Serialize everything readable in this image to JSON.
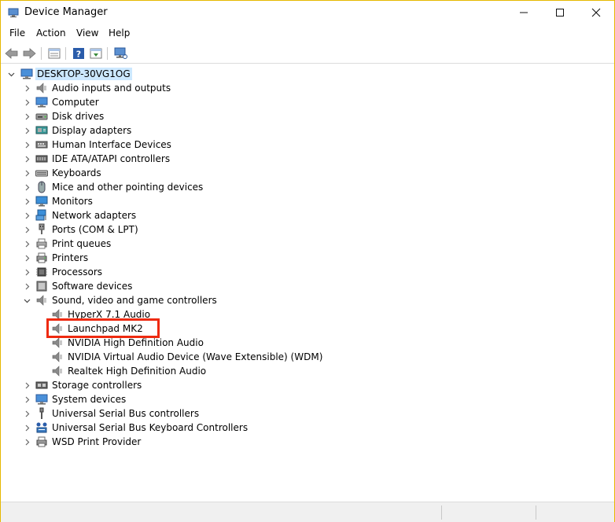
{
  "window": {
    "title": "Device Manager"
  },
  "menu": [
    "File",
    "Action",
    "View",
    "Help"
  ],
  "tree": {
    "root": "DESKTOP-30VG1OG",
    "categories": [
      {
        "label": "Audio inputs and outputs",
        "icon": "speaker-icon"
      },
      {
        "label": "Computer",
        "icon": "computer-icon"
      },
      {
        "label": "Disk drives",
        "icon": "disk-drive-icon"
      },
      {
        "label": "Display adapters",
        "icon": "display-adapter-icon"
      },
      {
        "label": "Human Interface Devices",
        "icon": "hid-icon"
      },
      {
        "label": "IDE ATA/ATAPI controllers",
        "icon": "ide-controller-icon"
      },
      {
        "label": "Keyboards",
        "icon": "keyboard-icon"
      },
      {
        "label": "Mice and other pointing devices",
        "icon": "mouse-icon"
      },
      {
        "label": "Monitors",
        "icon": "monitor-icon"
      },
      {
        "label": "Network adapters",
        "icon": "network-adapter-icon"
      },
      {
        "label": "Ports (COM & LPT)",
        "icon": "port-icon"
      },
      {
        "label": "Print queues",
        "icon": "print-queue-icon"
      },
      {
        "label": "Printers",
        "icon": "printer-icon"
      },
      {
        "label": "Processors",
        "icon": "processor-icon"
      },
      {
        "label": "Software devices",
        "icon": "software-device-icon"
      },
      {
        "label": "Sound, video and game controllers",
        "icon": "speaker-icon"
      }
    ],
    "sound_children": [
      "HyperX 7.1 Audio",
      "Launchpad MK2",
      "NVIDIA High Definition Audio",
      "NVIDIA Virtual Audio Device (Wave Extensible) (WDM)",
      "Realtek High Definition Audio"
    ],
    "categories_after": [
      {
        "label": "Storage controllers",
        "icon": "storage-controller-icon"
      },
      {
        "label": "System devices",
        "icon": "system-device-icon"
      },
      {
        "label": "Universal Serial Bus controllers",
        "icon": "usb-icon"
      },
      {
        "label": "Universal Serial Bus Keyboard Controllers",
        "icon": "usb-keyboard-icon"
      },
      {
        "label": "WSD Print Provider",
        "icon": "wsd-print-icon"
      }
    ]
  },
  "colors": {
    "selection": "#cce8ff",
    "highlight_box": "#ee2a10",
    "window_border": "#e6b800"
  }
}
